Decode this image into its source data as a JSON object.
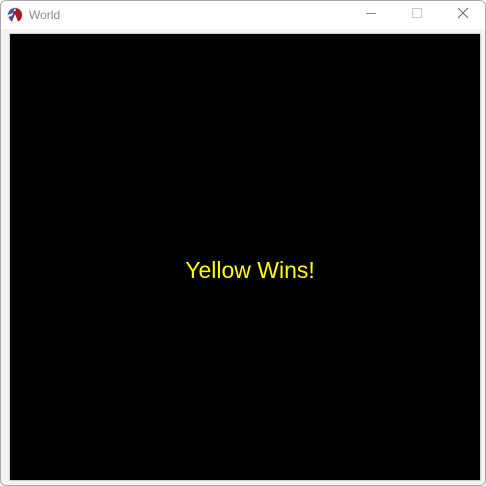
{
  "window": {
    "title": "World",
    "app_icon": "racket-logo-icon",
    "controls": [
      "minimize-icon",
      "maximize-icon",
      "close-icon"
    ]
  },
  "canvas": {
    "background": "#000000",
    "message": "Yellow Wins!",
    "message_color": "#ffff00"
  }
}
